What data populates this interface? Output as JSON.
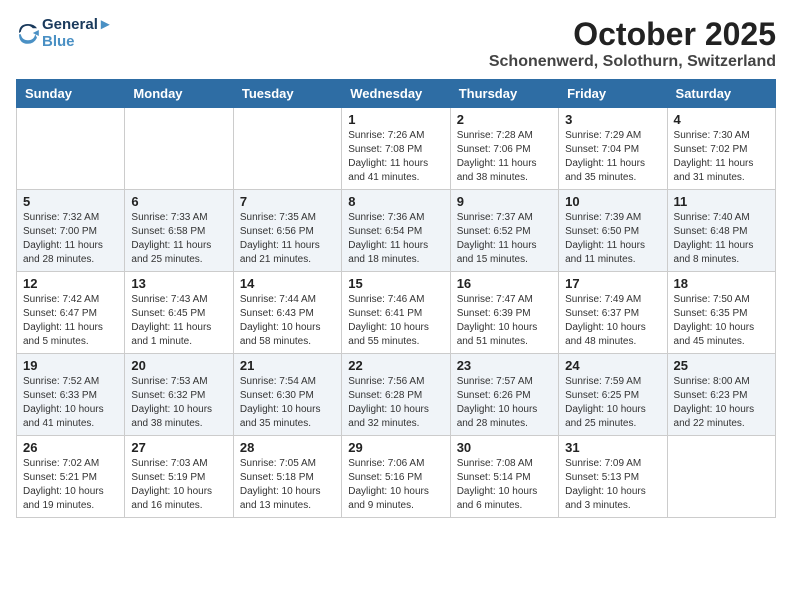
{
  "header": {
    "logo_line1": "General",
    "logo_line2": "Blue",
    "month_title": "October 2025",
    "location": "Schonenwerd, Solothurn, Switzerland"
  },
  "weekdays": [
    "Sunday",
    "Monday",
    "Tuesday",
    "Wednesday",
    "Thursday",
    "Friday",
    "Saturday"
  ],
  "weeks": [
    [
      {
        "day": "",
        "info": ""
      },
      {
        "day": "",
        "info": ""
      },
      {
        "day": "",
        "info": ""
      },
      {
        "day": "1",
        "info": "Sunrise: 7:26 AM\nSunset: 7:08 PM\nDaylight: 11 hours\nand 41 minutes."
      },
      {
        "day": "2",
        "info": "Sunrise: 7:28 AM\nSunset: 7:06 PM\nDaylight: 11 hours\nand 38 minutes."
      },
      {
        "day": "3",
        "info": "Sunrise: 7:29 AM\nSunset: 7:04 PM\nDaylight: 11 hours\nand 35 minutes."
      },
      {
        "day": "4",
        "info": "Sunrise: 7:30 AM\nSunset: 7:02 PM\nDaylight: 11 hours\nand 31 minutes."
      }
    ],
    [
      {
        "day": "5",
        "info": "Sunrise: 7:32 AM\nSunset: 7:00 PM\nDaylight: 11 hours\nand 28 minutes."
      },
      {
        "day": "6",
        "info": "Sunrise: 7:33 AM\nSunset: 6:58 PM\nDaylight: 11 hours\nand 25 minutes."
      },
      {
        "day": "7",
        "info": "Sunrise: 7:35 AM\nSunset: 6:56 PM\nDaylight: 11 hours\nand 21 minutes."
      },
      {
        "day": "8",
        "info": "Sunrise: 7:36 AM\nSunset: 6:54 PM\nDaylight: 11 hours\nand 18 minutes."
      },
      {
        "day": "9",
        "info": "Sunrise: 7:37 AM\nSunset: 6:52 PM\nDaylight: 11 hours\nand 15 minutes."
      },
      {
        "day": "10",
        "info": "Sunrise: 7:39 AM\nSunset: 6:50 PM\nDaylight: 11 hours\nand 11 minutes."
      },
      {
        "day": "11",
        "info": "Sunrise: 7:40 AM\nSunset: 6:48 PM\nDaylight: 11 hours\nand 8 minutes."
      }
    ],
    [
      {
        "day": "12",
        "info": "Sunrise: 7:42 AM\nSunset: 6:47 PM\nDaylight: 11 hours\nand 5 minutes."
      },
      {
        "day": "13",
        "info": "Sunrise: 7:43 AM\nSunset: 6:45 PM\nDaylight: 11 hours\nand 1 minute."
      },
      {
        "day": "14",
        "info": "Sunrise: 7:44 AM\nSunset: 6:43 PM\nDaylight: 10 hours\nand 58 minutes."
      },
      {
        "day": "15",
        "info": "Sunrise: 7:46 AM\nSunset: 6:41 PM\nDaylight: 10 hours\nand 55 minutes."
      },
      {
        "day": "16",
        "info": "Sunrise: 7:47 AM\nSunset: 6:39 PM\nDaylight: 10 hours\nand 51 minutes."
      },
      {
        "day": "17",
        "info": "Sunrise: 7:49 AM\nSunset: 6:37 PM\nDaylight: 10 hours\nand 48 minutes."
      },
      {
        "day": "18",
        "info": "Sunrise: 7:50 AM\nSunset: 6:35 PM\nDaylight: 10 hours\nand 45 minutes."
      }
    ],
    [
      {
        "day": "19",
        "info": "Sunrise: 7:52 AM\nSunset: 6:33 PM\nDaylight: 10 hours\nand 41 minutes."
      },
      {
        "day": "20",
        "info": "Sunrise: 7:53 AM\nSunset: 6:32 PM\nDaylight: 10 hours\nand 38 minutes."
      },
      {
        "day": "21",
        "info": "Sunrise: 7:54 AM\nSunset: 6:30 PM\nDaylight: 10 hours\nand 35 minutes."
      },
      {
        "day": "22",
        "info": "Sunrise: 7:56 AM\nSunset: 6:28 PM\nDaylight: 10 hours\nand 32 minutes."
      },
      {
        "day": "23",
        "info": "Sunrise: 7:57 AM\nSunset: 6:26 PM\nDaylight: 10 hours\nand 28 minutes."
      },
      {
        "day": "24",
        "info": "Sunrise: 7:59 AM\nSunset: 6:25 PM\nDaylight: 10 hours\nand 25 minutes."
      },
      {
        "day": "25",
        "info": "Sunrise: 8:00 AM\nSunset: 6:23 PM\nDaylight: 10 hours\nand 22 minutes."
      }
    ],
    [
      {
        "day": "26",
        "info": "Sunrise: 7:02 AM\nSunset: 5:21 PM\nDaylight: 10 hours\nand 19 minutes."
      },
      {
        "day": "27",
        "info": "Sunrise: 7:03 AM\nSunset: 5:19 PM\nDaylight: 10 hours\nand 16 minutes."
      },
      {
        "day": "28",
        "info": "Sunrise: 7:05 AM\nSunset: 5:18 PM\nDaylight: 10 hours\nand 13 minutes."
      },
      {
        "day": "29",
        "info": "Sunrise: 7:06 AM\nSunset: 5:16 PM\nDaylight: 10 hours\nand 9 minutes."
      },
      {
        "day": "30",
        "info": "Sunrise: 7:08 AM\nSunset: 5:14 PM\nDaylight: 10 hours\nand 6 minutes."
      },
      {
        "day": "31",
        "info": "Sunrise: 7:09 AM\nSunset: 5:13 PM\nDaylight: 10 hours\nand 3 minutes."
      },
      {
        "day": "",
        "info": ""
      }
    ]
  ]
}
